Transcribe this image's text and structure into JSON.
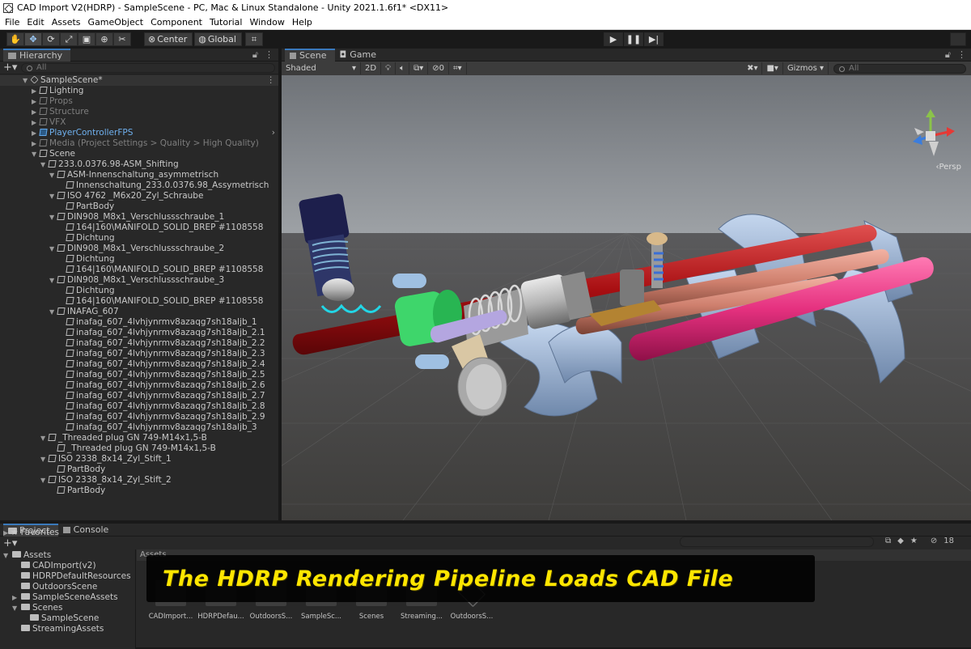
{
  "window": {
    "title": "CAD Import V2(HDRP) - SampleScene - PC, Mac & Linux Standalone - Unity 2021.1.6f1* <DX11>"
  },
  "menu": [
    "File",
    "Edit",
    "Assets",
    "GameObject",
    "Component",
    "Tutorial",
    "Window",
    "Help"
  ],
  "toolbar": {
    "tools": [
      "hand-tool",
      "move-tool",
      "rotate-tool",
      "scale-tool",
      "rect-tool",
      "transform-tool",
      "custom-tool"
    ],
    "pivot_label": "Center",
    "space_label": "Global",
    "play": [
      "play",
      "pause",
      "step"
    ]
  },
  "hierarchy": {
    "tab": "Hierarchy",
    "search_placeholder": "All",
    "rows": [
      {
        "text": "SampleScene*",
        "depth": 0,
        "arrow": "down",
        "icon": "unity",
        "kind": "scene"
      },
      {
        "text": "Lighting",
        "depth": 1,
        "arrow": "right",
        "icon": "cube",
        "kind": "normal"
      },
      {
        "text": "Props",
        "depth": 1,
        "arrow": "right",
        "icon": "cube",
        "kind": "dim"
      },
      {
        "text": "Structure",
        "depth": 1,
        "arrow": "right",
        "icon": "cube",
        "kind": "dim"
      },
      {
        "text": "VFX",
        "depth": 1,
        "arrow": "right",
        "icon": "cube",
        "kind": "dim"
      },
      {
        "text": "PlayerControllerFPS",
        "depth": 1,
        "arrow": "right",
        "icon": "cube-blue",
        "kind": "prefab"
      },
      {
        "text": "Media (Project Settings > Quality > High Quality)",
        "depth": 1,
        "arrow": "right",
        "icon": "cube",
        "kind": "dim"
      },
      {
        "text": "Scene",
        "depth": 1,
        "arrow": "down",
        "icon": "cube",
        "kind": "normal"
      },
      {
        "text": "233.0.0376.98-ASM_Shifting",
        "depth": 2,
        "arrow": "down",
        "icon": "cube",
        "kind": "normal"
      },
      {
        "text": "ASM-Innenschaltung_asymmetrisch",
        "depth": 3,
        "arrow": "down",
        "icon": "cube",
        "kind": "normal"
      },
      {
        "text": "Innenschaltung_233.0.0376.98_Assymetrisch",
        "depth": 4,
        "arrow": "",
        "icon": "cube",
        "kind": "normal"
      },
      {
        "text": "ISO 4762 _M6x20_Zyl_Schraube",
        "depth": 3,
        "arrow": "down",
        "icon": "cube",
        "kind": "normal"
      },
      {
        "text": "PartBody",
        "depth": 4,
        "arrow": "",
        "icon": "cube",
        "kind": "normal"
      },
      {
        "text": "DIN908_M8x1_Verschlussschraube_1",
        "depth": 3,
        "arrow": "down",
        "icon": "cube",
        "kind": "normal"
      },
      {
        "text": "164|160\\MANIFOLD_SOLID_BREP #1108558",
        "depth": 4,
        "arrow": "",
        "icon": "cube",
        "kind": "normal"
      },
      {
        "text": "Dichtung",
        "depth": 4,
        "arrow": "",
        "icon": "cube",
        "kind": "normal"
      },
      {
        "text": "DIN908_M8x1_Verschlussschraube_2",
        "depth": 3,
        "arrow": "down",
        "icon": "cube",
        "kind": "normal"
      },
      {
        "text": "Dichtung",
        "depth": 4,
        "arrow": "",
        "icon": "cube",
        "kind": "normal"
      },
      {
        "text": "164|160\\MANIFOLD_SOLID_BREP #1108558",
        "depth": 4,
        "arrow": "",
        "icon": "cube",
        "kind": "normal"
      },
      {
        "text": "DIN908_M8x1_Verschlussschraube_3",
        "depth": 3,
        "arrow": "down",
        "icon": "cube",
        "kind": "normal"
      },
      {
        "text": "Dichtung",
        "depth": 4,
        "arrow": "",
        "icon": "cube",
        "kind": "normal"
      },
      {
        "text": "164|160\\MANIFOLD_SOLID_BREP #1108558",
        "depth": 4,
        "arrow": "",
        "icon": "cube",
        "kind": "normal"
      },
      {
        "text": "INAFAG_607",
        "depth": 3,
        "arrow": "down",
        "icon": "cube",
        "kind": "normal"
      },
      {
        "text": "inafag_607_4lvhjynrmv8azaqg7sh18aljb_1",
        "depth": 4,
        "arrow": "",
        "icon": "cube",
        "kind": "normal"
      },
      {
        "text": "inafag_607_4lvhjynrmv8azaqg7sh18aljb_2.1",
        "depth": 4,
        "arrow": "",
        "icon": "cube",
        "kind": "normal"
      },
      {
        "text": "inafag_607_4lvhjynrmv8azaqg7sh18aljb_2.2",
        "depth": 4,
        "arrow": "",
        "icon": "cube",
        "kind": "normal"
      },
      {
        "text": "inafag_607_4lvhjynrmv8azaqg7sh18aljb_2.3",
        "depth": 4,
        "arrow": "",
        "icon": "cube",
        "kind": "normal"
      },
      {
        "text": "inafag_607_4lvhjynrmv8azaqg7sh18aljb_2.4",
        "depth": 4,
        "arrow": "",
        "icon": "cube",
        "kind": "normal"
      },
      {
        "text": "inafag_607_4lvhjynrmv8azaqg7sh18aljb_2.5",
        "depth": 4,
        "arrow": "",
        "icon": "cube",
        "kind": "normal"
      },
      {
        "text": "inafag_607_4lvhjynrmv8azaqg7sh18aljb_2.6",
        "depth": 4,
        "arrow": "",
        "icon": "cube",
        "kind": "normal"
      },
      {
        "text": "inafag_607_4lvhjynrmv8azaqg7sh18aljb_2.7",
        "depth": 4,
        "arrow": "",
        "icon": "cube",
        "kind": "normal"
      },
      {
        "text": "inafag_607_4lvhjynrmv8azaqg7sh18aljb_2.8",
        "depth": 4,
        "arrow": "",
        "icon": "cube",
        "kind": "normal"
      },
      {
        "text": "inafag_607_4lvhjynrmv8azaqg7sh18aljb_2.9",
        "depth": 4,
        "arrow": "",
        "icon": "cube",
        "kind": "normal"
      },
      {
        "text": "inafag_607_4lvhjynrmv8azaqg7sh18aljb_3",
        "depth": 4,
        "arrow": "",
        "icon": "cube",
        "kind": "normal"
      },
      {
        "text": "_Threaded plug GN 749-M14x1,5-B",
        "depth": 2,
        "arrow": "down",
        "icon": "cube",
        "kind": "normal"
      },
      {
        "text": "_Threaded plug GN 749-M14x1,5-B",
        "depth": 3,
        "arrow": "",
        "icon": "cube",
        "kind": "normal"
      },
      {
        "text": "ISO 2338_8x14_Zyl_Stift_1",
        "depth": 2,
        "arrow": "down",
        "icon": "cube",
        "kind": "normal"
      },
      {
        "text": "PartBody",
        "depth": 3,
        "arrow": "",
        "icon": "cube",
        "kind": "normal"
      },
      {
        "text": "ISO 2338_8x14_Zyl_Stift_2",
        "depth": 2,
        "arrow": "down",
        "icon": "cube",
        "kind": "normal"
      },
      {
        "text": "PartBody",
        "depth": 3,
        "arrow": "",
        "icon": "cube",
        "kind": "normal"
      }
    ]
  },
  "scene": {
    "tabs": [
      "Scene",
      "Game"
    ],
    "shading": "Shaded",
    "mode2d": "2D",
    "hidden_count": "0",
    "gizmos": "Gizmos",
    "search_placeholder": "All",
    "persp_label": "‹Persp"
  },
  "project": {
    "tabs": [
      "Project",
      "Console"
    ],
    "favorites": "Favorites",
    "folders": [
      {
        "text": "Assets",
        "depth": 0,
        "arrow": "down"
      },
      {
        "text": "CADImport(v2)",
        "depth": 1,
        "arrow": ""
      },
      {
        "text": "HDRPDefaultResources",
        "depth": 1,
        "arrow": ""
      },
      {
        "text": "OutdoorsScene",
        "depth": 1,
        "arrow": ""
      },
      {
        "text": "SampleSceneAssets",
        "depth": 1,
        "arrow": "right"
      },
      {
        "text": "Scenes",
        "depth": 1,
        "arrow": "down"
      },
      {
        "text": "SampleScene",
        "depth": 2,
        "arrow": ""
      },
      {
        "text": "StreamingAssets",
        "depth": 1,
        "arrow": ""
      }
    ],
    "breadcrumb": "Assets",
    "assets": [
      "CADImport...",
      "HDRPDefau...",
      "OutdoorsS...",
      "SampleSc...",
      "Scenes",
      "Streaming...",
      "OutdoorsS..."
    ],
    "hidden_count": "18"
  },
  "banner": "The HDRP Rendering Pipeline Loads CAD File"
}
